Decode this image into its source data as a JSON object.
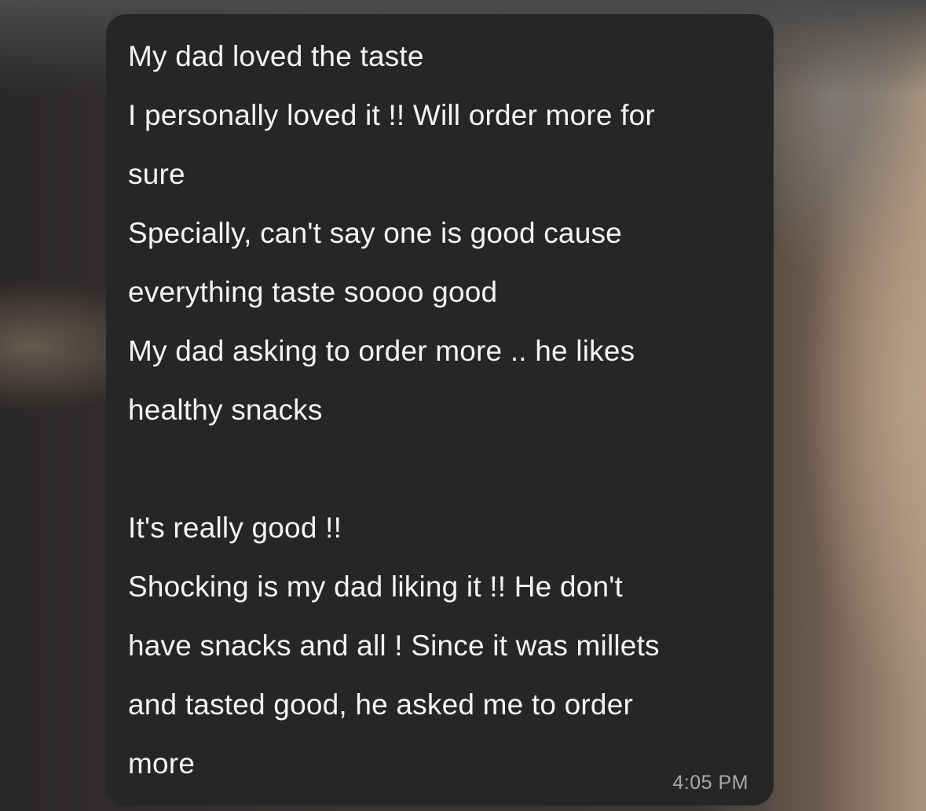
{
  "message": {
    "lines": [
      "My dad loved the taste",
      "I personally loved it !! Will order more for",
      "sure",
      "Specially, can't say one is good cause",
      "everything taste soooo good",
      "My dad asking to order more .. he likes",
      "healthy snacks",
      "",
      "It's really good !!",
      "Shocking is my dad liking it !! He don't",
      "have snacks and all ! Since it was millets",
      "and tasted good, he asked me to order",
      "more"
    ],
    "timestamp": "4:05 PM"
  }
}
